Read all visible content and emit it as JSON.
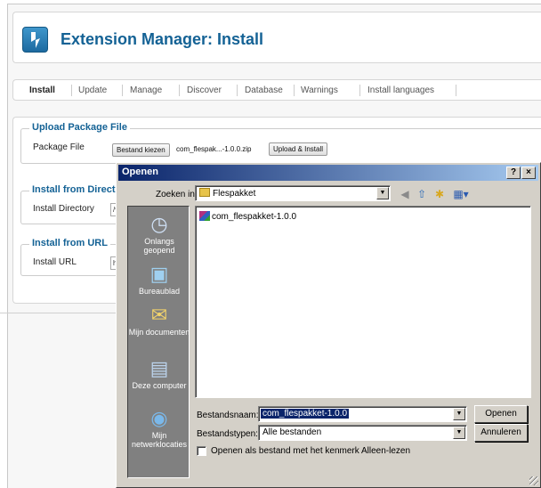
{
  "header": {
    "title": "Extension Manager: Install"
  },
  "tabs": [
    {
      "label": "Install",
      "active": true
    },
    {
      "label": "Update"
    },
    {
      "label": "Manage"
    },
    {
      "label": "Discover"
    },
    {
      "label": "Database"
    },
    {
      "label": "Warnings"
    },
    {
      "label": "Install languages"
    }
  ],
  "upload": {
    "legend": "Upload Package File",
    "label": "Package File",
    "choose_button": "Bestand kiezen",
    "file_name": "com_flespak...-1.0.0.zip",
    "install_button": "Upload & Install"
  },
  "directory": {
    "legend": "Install from Direct",
    "label": "Install Directory",
    "value": "/va"
  },
  "url": {
    "legend": "Install from URL",
    "label": "Install URL",
    "value": "htt"
  },
  "dialog": {
    "title": "Openen",
    "help_button": "?",
    "close_button": "×",
    "lookin_label": "Zoeken in:",
    "lookin_value": "Flespakket",
    "places": [
      {
        "label": "Onlangs geopend",
        "icon": "recent-icon"
      },
      {
        "label": "Bureaublad",
        "icon": "desktop-icon"
      },
      {
        "label": "Mijn documenten",
        "icon": "documents-icon"
      },
      {
        "label": "Deze computer",
        "icon": "computer-icon"
      },
      {
        "label": "Mijn netwerklocaties",
        "icon": "network-icon"
      }
    ],
    "files": [
      "com_flespakket-1.0.0"
    ],
    "filename_label": "Bestandsnaam:",
    "filename_value": "com_flespakket-1.0.0",
    "filetype_label": "Bestandstypen:",
    "filetype_value": "Alle bestanden",
    "readonly_label": "Openen als bestand met het kenmerk Alleen-lezen",
    "open_button": "Openen",
    "cancel_button": "Annuleren"
  },
  "colors": {
    "joomla_blue": "#146295",
    "titlebar": "#0a246a",
    "dialog_bg": "#d4d0c8"
  }
}
